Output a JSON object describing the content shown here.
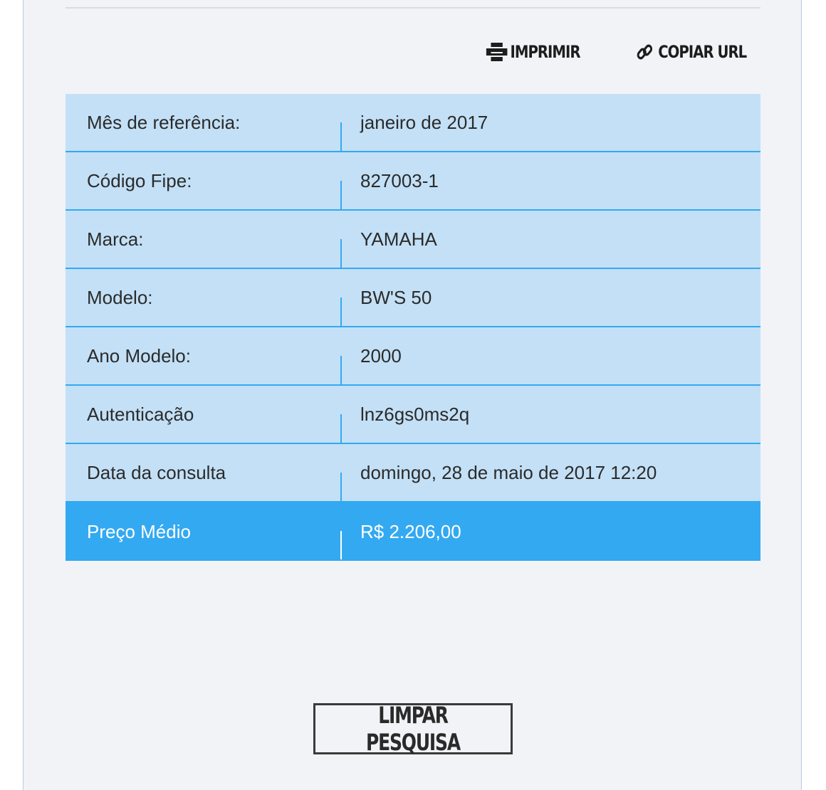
{
  "toolbar": {
    "print": {
      "label": "IMPRIMIR",
      "icon": "printer-icon"
    },
    "copy_url": {
      "label": "COPIAR URL",
      "icon": "link-icon"
    }
  },
  "result": {
    "rows": [
      {
        "label": "Mês de referência:",
        "value": "janeiro de 2017"
      },
      {
        "label": "Código Fipe:",
        "value": "827003-1"
      },
      {
        "label": "Marca:",
        "value": "YAMAHA"
      },
      {
        "label": "Modelo:",
        "value": "BW'S 50"
      },
      {
        "label": "Ano Modelo:",
        "value": "2000"
      },
      {
        "label": "Autenticação",
        "value": "lnz6gs0ms2q"
      },
      {
        "label": "Data da consulta",
        "value": "domingo, 28 de maio de 2017 12:20"
      }
    ],
    "price": {
      "label": "Preço Médio",
      "value": "R$ 2.206,00"
    }
  },
  "clear_button": {
    "label": "LIMPAR PESQUISA"
  },
  "colors": {
    "row_bg": "#c3e0f6",
    "accent": "#33a9f1",
    "panel_bg": "#f2f3f7",
    "text": "#2b2b2b"
  }
}
